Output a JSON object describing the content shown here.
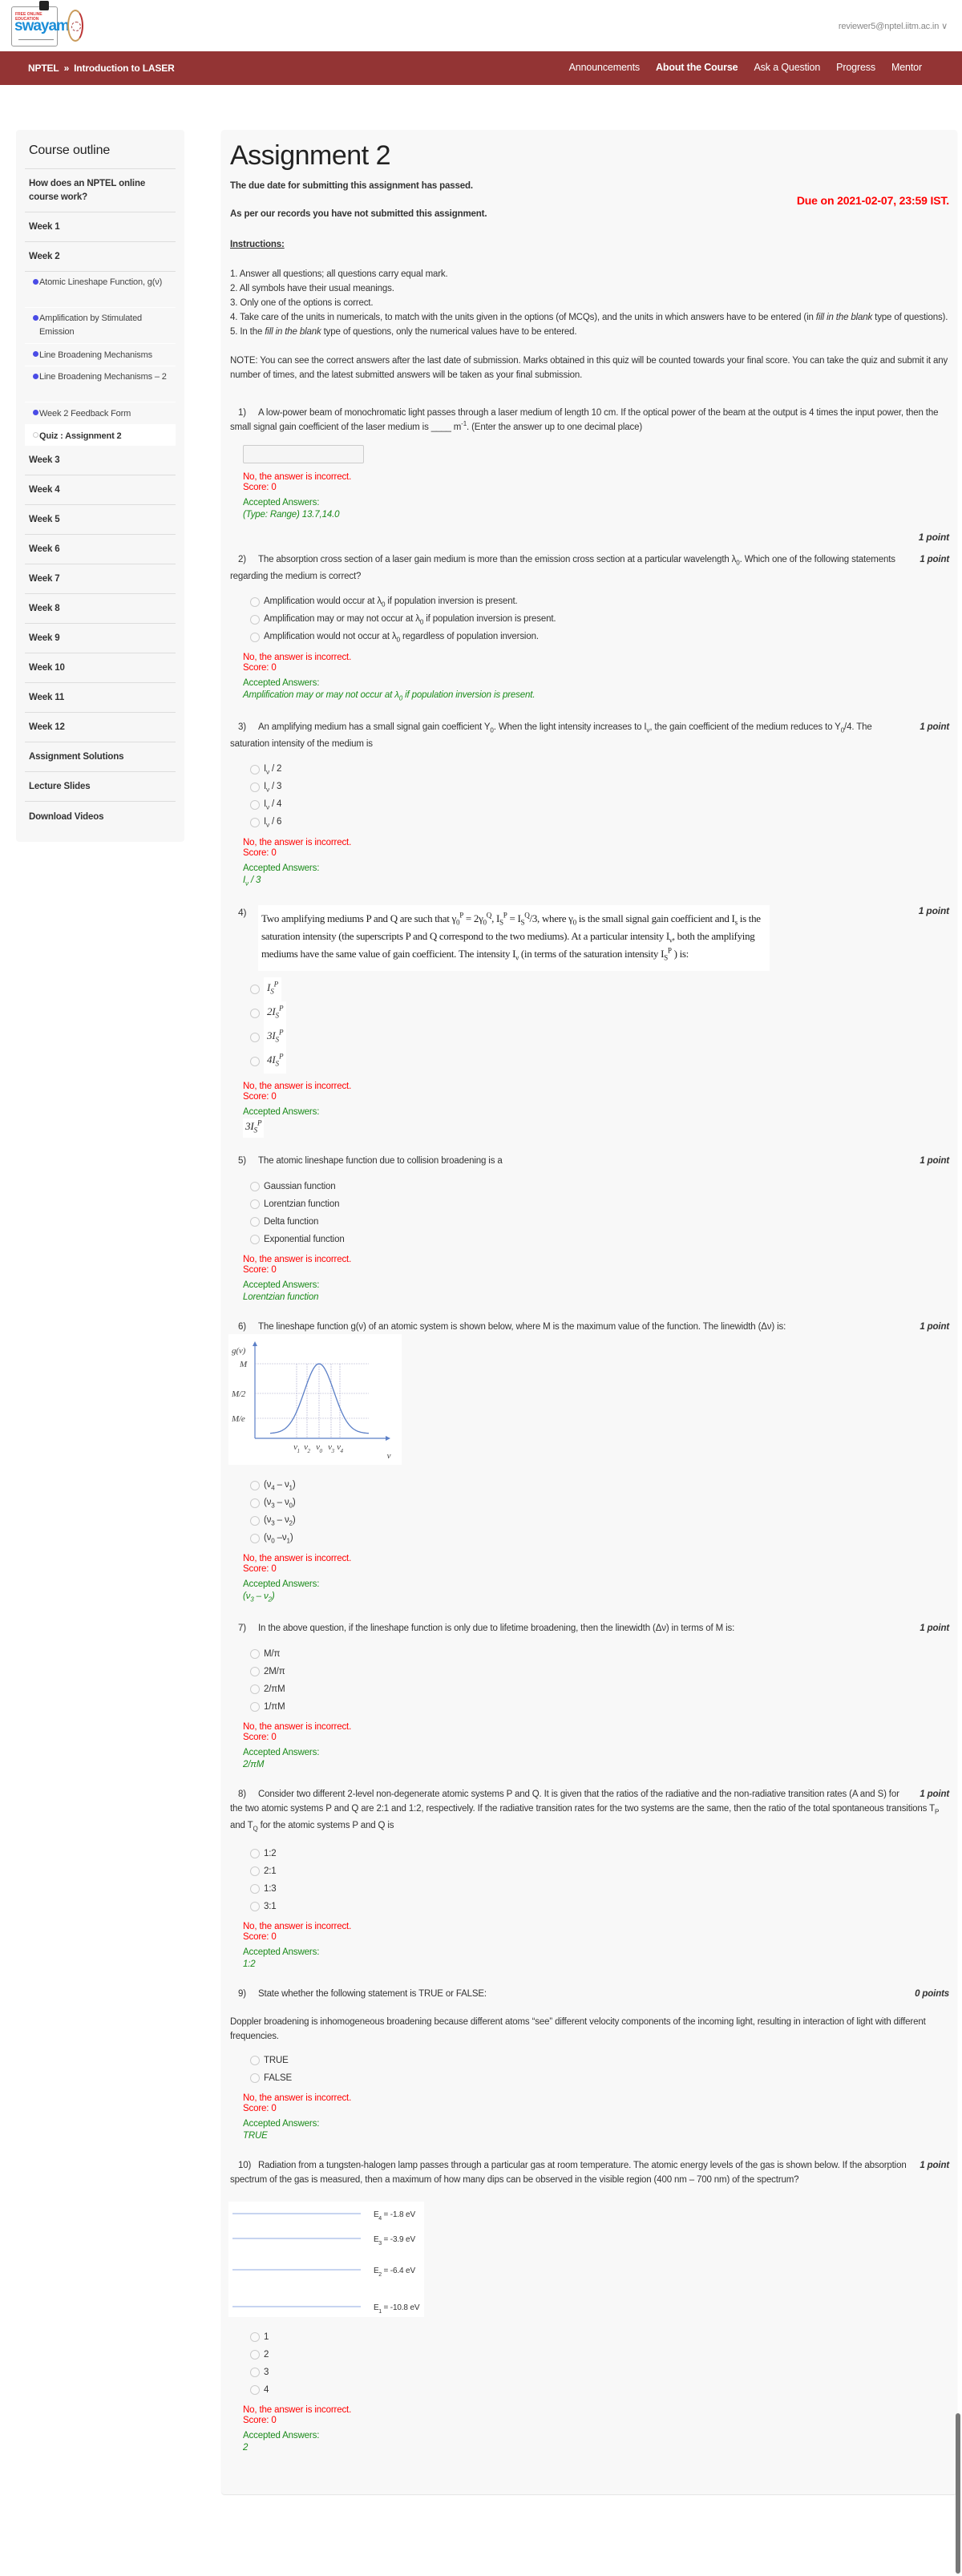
{
  "header": {
    "logo_text": "swayam",
    "logo_tagline": "FREE ONLINE EDUCATION",
    "user_email": "reviewer5@nptel.iitm.ac.in ∨"
  },
  "nav": {
    "breadcrumb": [
      "NPTEL",
      "»",
      "Introduction to LASER"
    ],
    "links": [
      "Announcements",
      "About the Course",
      "Ask a Question",
      "Progress",
      "Mentor"
    ],
    "color": "#933434"
  },
  "sidebar": {
    "title": "Course outline",
    "before": [
      {
        "label": "How does an NPTEL online course work?",
        "double": true
      },
      {
        "label": "Week 1"
      },
      {
        "label": "Week 2"
      }
    ],
    "week2_items": [
      {
        "label": "Atomic Lineshape Function, g(ν)"
      },
      {
        "label": "Amplification by Stimulated Emission"
      },
      {
        "label": "Line Broadening Mechanisms"
      },
      {
        "label": "Line Broadening Mechanisms – 2"
      },
      {
        "label": "Week 2 Feedback Form"
      },
      {
        "label": "Quiz : Assignment 2",
        "active": true
      }
    ],
    "after": [
      "Week 3",
      "Week 4",
      "Week 5",
      "Week 6",
      "Week 7",
      "Week 8",
      "Week 9",
      "Week 10",
      "Week 11",
      "Week 12",
      "Assignment Solutions",
      "Lecture Slides",
      "Download Videos"
    ],
    "bullet_color": "#4a4ce6"
  },
  "main": {
    "title": "Assignment 2",
    "due_passed": "The due date for submitting this assignment has passed.",
    "due_on": "Due on 2021-02-07, 23:59 IST.",
    "not_submitted": "As per our records you have not submitted this assignment.",
    "instructions_heading": "Instructions:",
    "instructions": [
      "1. Answer all questions; all questions carry equal mark.",
      "2. All symbols have their usual meanings.",
      "3. Only one of the options is correct.",
      "4. Take care of the units in numericals, to match with the units given in the options (of MCQs), and the units in which answers have to be entered (in fill in the blank type of questions).",
      "5. In the fill in the blank type of questions, only the numerical values have to be entered."
    ],
    "note": "NOTE: You can see the correct answers after the last date of submission. Marks obtained in this quiz will be counted towards your final score. You can take the quiz and submit it any number of times, and the latest submitted answers will be taken as your final submission."
  },
  "feedback_labels": {
    "incorrect": "No, the answer is incorrect.",
    "score": "Score: 0",
    "accepted": "Accepted Answers:"
  },
  "colors": {
    "incorrect": "#ff0000",
    "accepted": "#1a8a1a",
    "due": "#ff0000"
  },
  "questions": [
    {
      "num": "1)",
      "text": "A low-power beam of monochromatic light passes through a laser medium of length 10 cm. If the optical power of the beam at the output is 4 times the input power, then the small signal gain coefficient of the laser medium is ____ m^{-1}. (Enter the answer up to one decimal place)",
      "points": "1 point",
      "points_after": true,
      "input_value": "",
      "accepted": "(Type: Range) 13.7,14.0"
    },
    {
      "num": "2)",
      "text": "The absorption cross section of a laser gain medium is more than the emission cross section at a particular wavelength λ_{0}. Which one of the following statements regarding the medium is correct?",
      "points": "1 point",
      "options": [
        "Amplification would occur at λ_{0} if population inversion is present.",
        "Amplification may or may not occur at λ_{0} if population inversion is present.",
        "Amplification would not occur at λ_{0} regardless of population inversion."
      ],
      "accepted": "Amplification may or may not occur at λ_{0} if population inversion is present."
    },
    {
      "num": "3)",
      "text": "An amplifying medium has a small signal gain coefficient Y_{0}. When the light intensity increases to I_{ν}, the gain coefficient of the medium reduces to Y_{0}/4. The saturation intensity of the medium is",
      "points": "1 point",
      "options": [
        "I_{ν} / 2",
        "I_{ν} / 3",
        "I_{ν} / 4",
        "I_{ν} / 6"
      ],
      "accepted": "I_{ν} / 3"
    },
    {
      "num": "4)",
      "boxed": true,
      "text": "Two amplifying mediums P and Q are such that γ_{0}^{P} = 2γ_{0}^{Q}, I_{S}^{P} = I_{S}^{Q}/3, where γ_{0} is the small signal gain coefficient and I_{s} is the saturation intensity (the superscripts P and Q correspond to the two mediums). At a particular intensity I_{ν}, both the amplifying mediums have the same value of gain coefficient. The intensity I_{ν} (in terms of the saturation intensity I_{S}^{P} ) is:",
      "points": "1 point",
      "options": [
        "I_{S}^{P}",
        "2I_{S}^{P}",
        "3I_{S}^{P}",
        "4I_{S}^{P}"
      ],
      "tall_options": true,
      "accepted": "3I_{S}^{P}",
      "accepted_serif": true
    },
    {
      "num": "5)",
      "text": "The atomic lineshape function due to collision broadening is a",
      "points": "1 point",
      "options": [
        "Gaussian function",
        "Lorentzian function",
        "Delta function",
        "Exponential function"
      ],
      "accepted": "Lorentzian function"
    },
    {
      "num": "6)",
      "text": "The lineshape function g(ν) of an atomic system is shown below, where M is the maximum value of the function. The linewidth (Δν) is:",
      "points": "1 point",
      "figure": "lineshape",
      "options": [
        "(ν_{4} – ν_{1})",
        "(ν_{3} – ν_{0})",
        "(ν_{3} – ν_{2})",
        "(ν_{0} –ν_{1})"
      ],
      "accepted": "(ν_{3} – ν_{2})"
    },
    {
      "num": "7)",
      "text": "In the above question, if the lineshape function is only due to lifetime broadening, then the linewidth (Δν) in terms of M is:",
      "points": "1 point",
      "options": [
        "M/π",
        "2M/π",
        "2/πM",
        "1/πM"
      ],
      "accepted": "2/πM"
    },
    {
      "num": "8)",
      "text": "Consider two different 2-level non-degenerate atomic systems P and Q. It is given that the ratios of the radiative and the non-radiative transition rates (A and S) for the two atomic systems P and Q are 2:1 and 1:2, respectively. If the radiative transition rates for the two systems are the same, then the ratio of the total spontaneous transitions T_{P} and T_{Q} for the atomic systems P and Q is",
      "points": "1 point",
      "options": [
        "1:2",
        "2:1",
        "1:3",
        "3:1"
      ],
      "accepted": "1:2"
    },
    {
      "num": "9)",
      "text": "State whether the following statement is TRUE or FALSE:",
      "points": "0 points",
      "statement": "Doppler broadening is inhomogeneous broadening because different atoms “see” different velocity components of the incoming light, resulting in interaction of light with different frequencies.",
      "options": [
        "TRUE",
        "FALSE"
      ],
      "accepted": "TRUE"
    },
    {
      "num": "10)",
      "text": "Radiation from a tungsten-halogen lamp passes through a particular gas at room temperature. The atomic energy levels of the gas is shown below. If the absorption spectrum of the gas is measured, then a maximum of how many dips can be observed in the visible region (400 nm – 700 nm) of the spectrum?",
      "points": "1 point",
      "figure": "levels",
      "options": [
        "1",
        "2",
        "3",
        "4"
      ],
      "accepted": "2"
    }
  ],
  "lineshape_figure": {
    "y_label": "g(ν)",
    "x_label": "ν",
    "y_ticks": [
      "M",
      "M/2",
      "M/e"
    ],
    "x_ticks": [
      "ν_{1}",
      "ν_{2}",
      "ν_{0}",
      "ν_{3}",
      "ν_{4}"
    ]
  },
  "levels_figure": {
    "levels": [
      "E_{4} = -1.8 eV",
      "E_{3} = -3.9 eV",
      "E_{2} = -6.4 eV",
      "E_{1} = -10.8 eV"
    ]
  }
}
